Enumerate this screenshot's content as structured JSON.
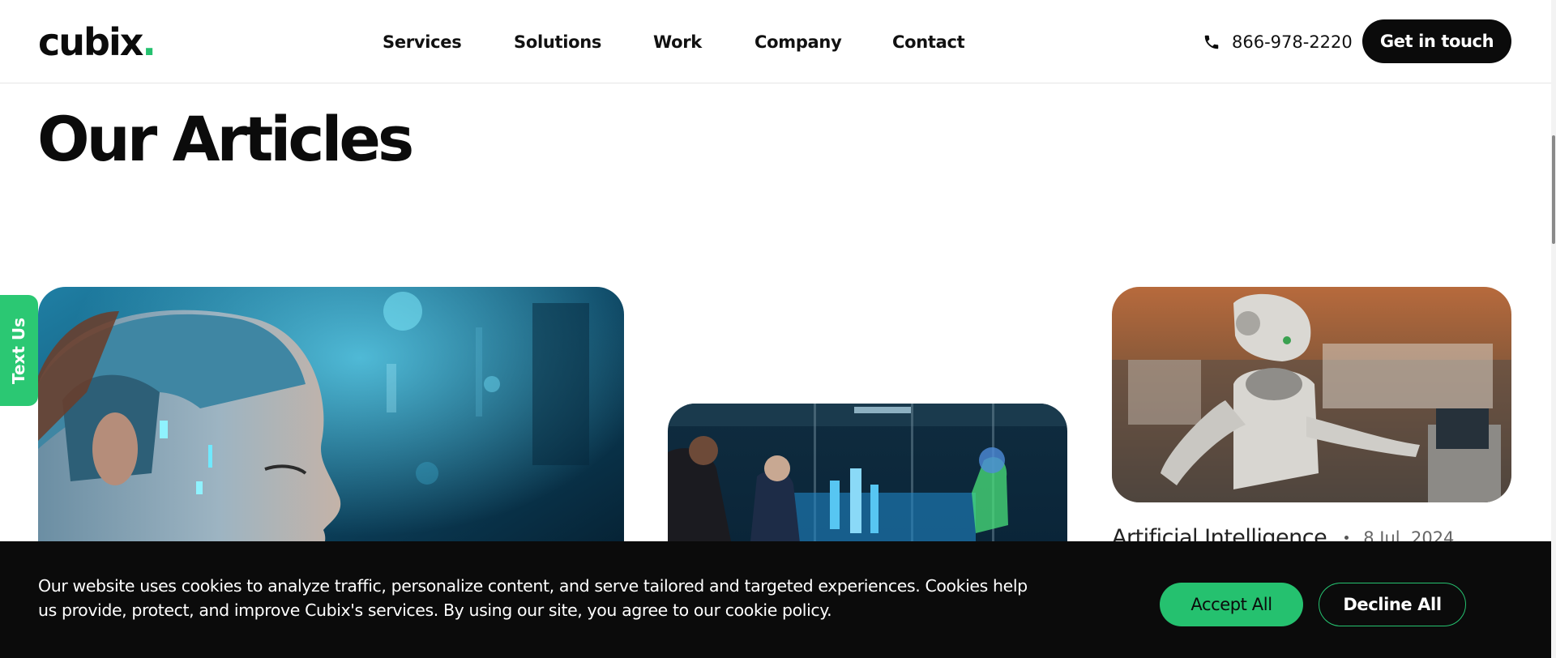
{
  "header": {
    "logo": {
      "text": "cubix",
      "dot": "."
    },
    "nav": [
      {
        "label": "Services"
      },
      {
        "label": "Solutions"
      },
      {
        "label": "Work"
      },
      {
        "label": "Company"
      },
      {
        "label": "Contact"
      }
    ],
    "phone": {
      "icon": "phone-icon",
      "number": "866-978-2220"
    },
    "cta_label": "Get in touch"
  },
  "page": {
    "title": "Our Articles",
    "text_us_label": "Text Us"
  },
  "articles": [
    {
      "image": "ai-woman-cyborg-head"
    },
    {
      "image": "office-hologram-assistant"
    },
    {
      "image": "humanoid-robot-at-store-counter",
      "category": "Artificial Intelligence",
      "date": "8 Jul, 2024"
    }
  ],
  "cookie_banner": {
    "text": "Our website uses cookies to analyze traffic, personalize content, and serve tailored and targeted experiences. Cookies help us provide, protect, and improve Cubix's services. By using our site, you agree to our cookie policy.",
    "accept_label": "Accept All",
    "decline_label": "Decline All"
  },
  "colors": {
    "brand_green": "#25c16f",
    "text_us_green": "#2bc873",
    "dark": "#0b0b0b",
    "white": "#ffffff"
  }
}
